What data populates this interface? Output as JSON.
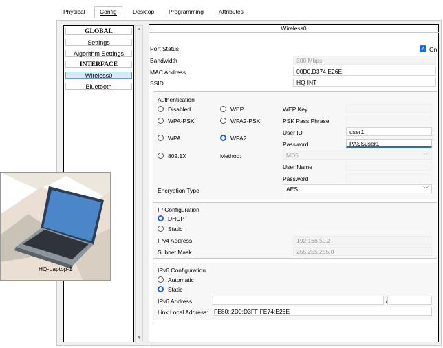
{
  "tabs": [
    {
      "label": "Physical"
    },
    {
      "label": "Config"
    },
    {
      "label": "Desktop"
    },
    {
      "label": "Programming"
    },
    {
      "label": "Attributes"
    }
  ],
  "sidebar": {
    "items": [
      {
        "label": "GLOBAL"
      },
      {
        "label": "Settings"
      },
      {
        "label": "Algorithm Settings"
      },
      {
        "label": "INTERFACE"
      },
      {
        "label": "Wireless0"
      },
      {
        "label": "Bluetooth"
      }
    ]
  },
  "interface": {
    "title": "Wireless0",
    "port_status_label": "Port Status",
    "port_on_label": "On",
    "bandwidth_label": "Bandwidth",
    "bandwidth_value": "300 Mbps",
    "mac_label": "MAC Address",
    "mac_value": "00D0.D374.E26E",
    "ssid_label": "SSID",
    "ssid_value": "HQ-INT"
  },
  "auth": {
    "heading": "Authentication",
    "disabled": "Disabled",
    "wep": "WEP",
    "wpa_psk": "WPA-PSK",
    "wpa2_psk": "WPA2-PSK",
    "wpa": "WPA",
    "wpa2": "WPA2",
    "dot1x": "802.1X",
    "method_label": "Method:",
    "wep_key_label": "WEP Key",
    "psk_label": "PSK Pass Phrase",
    "userid_label": "User ID",
    "userid_value": "user1",
    "password_label": "Password",
    "password_value": "PASSuser1",
    "method_value": "MD5",
    "username_label": "User Name",
    "password2_label": "Password",
    "encryption_label": "Encryption Type",
    "encryption_value": "AES"
  },
  "ip": {
    "heading": "IP Configuration",
    "dhcp": "DHCP",
    "static": "Static",
    "ipv4_label": "IPv4 Address",
    "ipv4_value": "192.168.50.2",
    "mask_label": "Subnet Mask",
    "mask_value": "255.255.255.0"
  },
  "ipv6": {
    "heading": "IPv6 Configuration",
    "automatic": "Automatic",
    "static": "Static",
    "addr_label": "IPv6 Address",
    "slash": "/",
    "link_local_label": "Link Local Address:",
    "link_local_value": "FE80::2D0:D3FF:FE74:E26E"
  },
  "device": {
    "label": "HQ-Laptop-1"
  },
  "colors": {
    "accent": "#1e6fd9"
  }
}
